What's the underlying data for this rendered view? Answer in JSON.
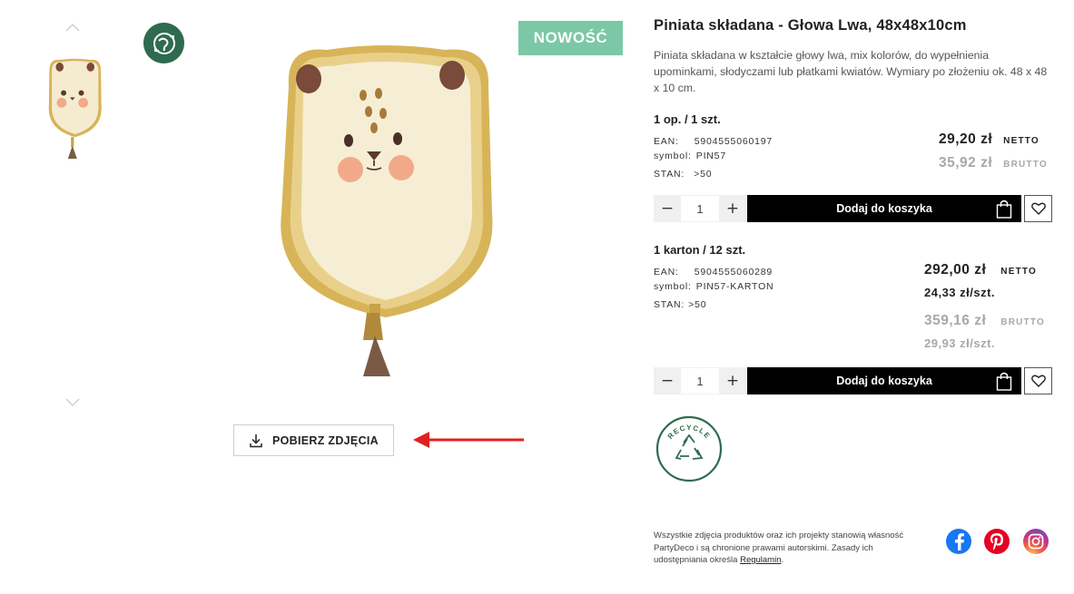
{
  "gallery": {
    "prev_icon": "chevron-up-icon",
    "next_icon": "chevron-down-icon",
    "eco_icon": "recycle-globe-icon",
    "download_label": "POBIERZ ZDJĘCIA",
    "download_icon": "download-icon"
  },
  "badge": {
    "new_label": "NOWOŚĆ",
    "color": "#7cc8a6"
  },
  "product": {
    "title": "Piniata składana - Głowa Lwa, 48x48x10cm",
    "description": "Piniata składana w kształcie głowy lwa, mix kolorów, do wypełnienia upominkami, słodyczami lub płatkami kwiatów. Wymiary po złożeniu ok. 48 x 48 x 10 cm."
  },
  "variants": [
    {
      "title": "1 op. / 1 szt.",
      "ean_label": "EAN:",
      "ean": "5904555060197",
      "symbol_label": "symbol:",
      "symbol": "PIN57",
      "stock_label": "STAN:",
      "stock": ">50",
      "net_price": "29,20 zł",
      "net_label": "NETTO",
      "gross_price": "35,92 zł",
      "gross_label": "BRUTTO",
      "qty_minus": "−",
      "qty_value": "1",
      "qty_plus": "+",
      "cart_label": "Dodaj do koszyka"
    },
    {
      "title": "1 karton / 12 szt.",
      "ean_label": "EAN:",
      "ean": "5904555060289",
      "symbol_label": "symbol:",
      "symbol": "PIN57-KARTON",
      "stock_label": "STAN:",
      "stock": ">50",
      "net_price": "292,00 zł",
      "net_label": "NETTO",
      "net_unit": "24,33 zł/szt.",
      "gross_price": "359,16 zł",
      "gross_label": "BRUTTO",
      "gross_unit": "29,93 zł/szt.",
      "qty_minus": "−",
      "qty_value": "1",
      "qty_plus": "+",
      "cart_label": "Dodaj do koszyka"
    }
  ],
  "recycle_label": "RECYCLE",
  "legal": {
    "text": "Wszystkie zdjęcia produktów oraz ich projekty stanowią własność PartyDeco i są chronione prawami autorskimi. Zasady ich udostępniania określa ",
    "link": "Regulamin",
    "end": "."
  },
  "social": [
    "facebook-icon",
    "pinterest-icon",
    "instagram-icon"
  ],
  "colors": {
    "accent_green": "#2f6b4f",
    "arrow_red": "#e02020",
    "button_black": "#000000"
  }
}
